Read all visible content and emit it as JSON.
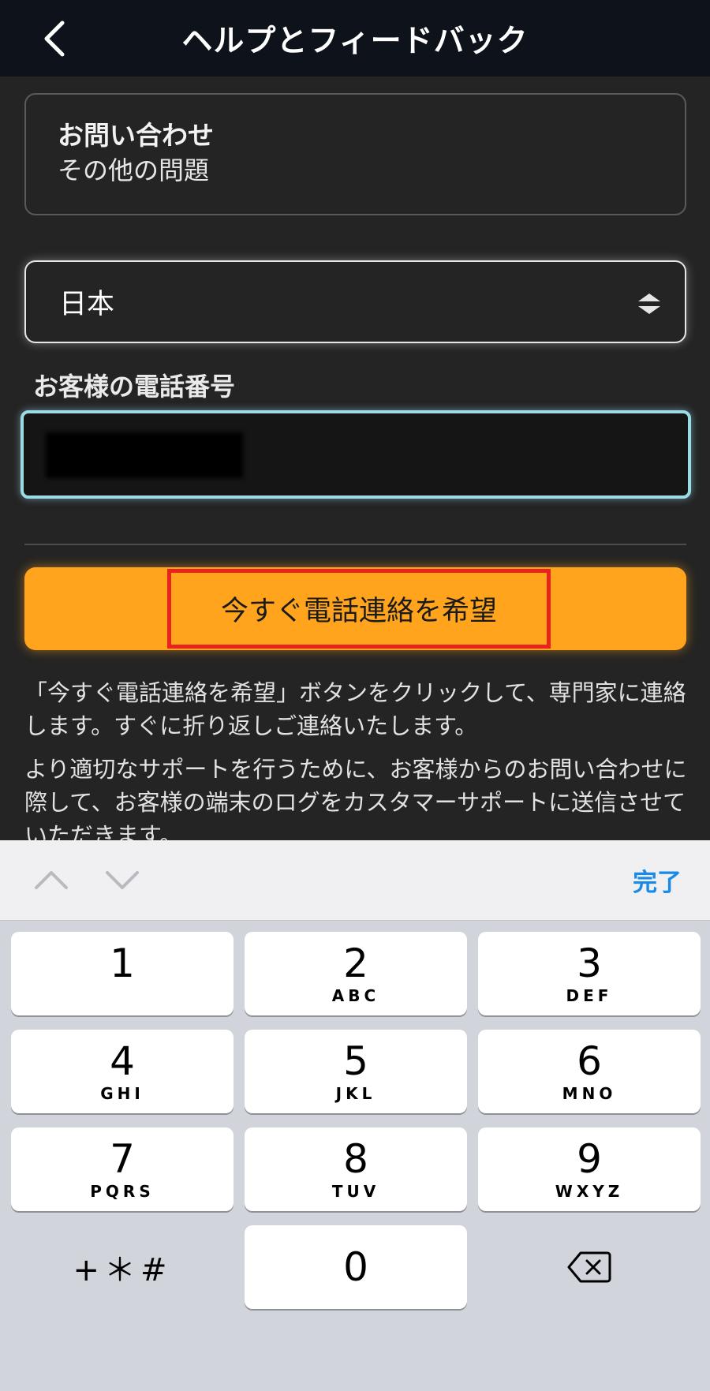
{
  "header": {
    "title": "ヘルプとフィードバック",
    "back_icon": "chevron-left-icon"
  },
  "topic": {
    "title": "お問い合わせ",
    "subtitle": "その他の問題"
  },
  "country": {
    "selected": "日本",
    "icon": "select-arrows-icon"
  },
  "phone": {
    "label": "お客様の電話番号",
    "value_redacted": true
  },
  "callback_button": {
    "label": "今すぐ電話連絡を希望"
  },
  "description": {
    "para1": "「今すぐ電話連絡を希望」ボタンをクリックして、専門家に連絡します。すぐに折り返しご連絡いたします。",
    "para2": "より適切なサポートを行うために、お客様からのお問い合わせに際して、お客様の端末のログをカスタマーサポートに送信させていただきます。"
  },
  "keyboard_toolbar": {
    "done_label": "完了",
    "prev_icon": "chevron-up-icon",
    "next_icon": "chevron-down-icon"
  },
  "keypad": {
    "keys": [
      {
        "num": "1",
        "letters": ""
      },
      {
        "num": "2",
        "letters": "ABC"
      },
      {
        "num": "3",
        "letters": "DEF"
      },
      {
        "num": "4",
        "letters": "GHI"
      },
      {
        "num": "5",
        "letters": "JKL"
      },
      {
        "num": "6",
        "letters": "MNO"
      },
      {
        "num": "7",
        "letters": "PQRS"
      },
      {
        "num": "8",
        "letters": "TUV"
      },
      {
        "num": "9",
        "letters": "WXYZ"
      },
      {
        "num": "0",
        "letters": ""
      }
    ],
    "symbols_label": "+＊#",
    "delete_icon": "backspace-icon"
  },
  "colors": {
    "header_bg": "#0e121b",
    "content_bg": "#242424",
    "accent_orange": "#ffa41c",
    "highlight_red": "#e8221c",
    "input_focus": "#9adbe6",
    "done_blue": "#1a8ae8",
    "keypad_bg": "#d2d4db"
  }
}
